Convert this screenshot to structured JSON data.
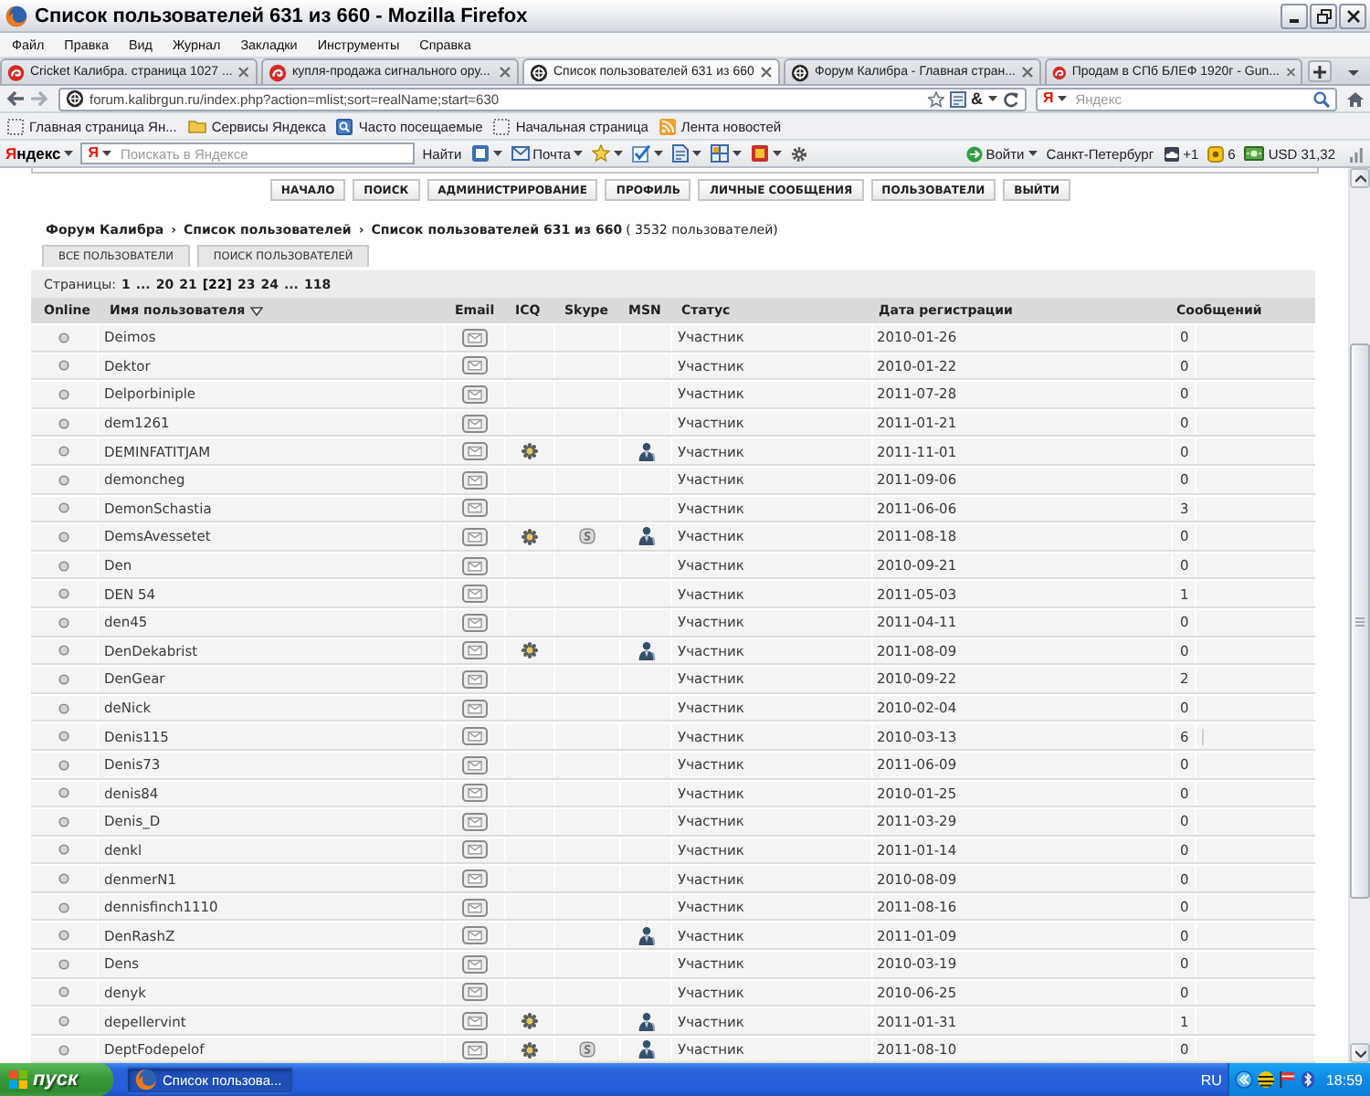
{
  "window": {
    "title": "Список пользователей 631 из 660 - Mozilla Firefox"
  },
  "menu": [
    "Файл",
    "Правка",
    "Вид",
    "Журнал",
    "Закладки",
    "Инструменты",
    "Справка"
  ],
  "tabs": [
    {
      "label": "Cricket Калибра. страница 1027 ...",
      "kind": "page",
      "selected": false
    },
    {
      "label": "купля-продажа сигнального ору...",
      "kind": "page",
      "selected": false
    },
    {
      "label": "Список пользователей 631 из 660",
      "kind": "forum",
      "selected": true
    },
    {
      "label": "Форум Калибра - Главная стран...",
      "kind": "forum",
      "selected": false
    },
    {
      "label": "Продам в СПб БЛЕФ 1920г - Gun...",
      "kind": "page",
      "selected": false
    }
  ],
  "address_bar": {
    "url": "forum.kalibrgun.ru/index.php?action=mlist;sort=realName;start=630",
    "addon": "&"
  },
  "search": {
    "engine": "Я",
    "placeholder": "Яндекс"
  },
  "bookmarks": [
    {
      "label": "Главная страница Ян...",
      "kind": "page"
    },
    {
      "label": "Сервисы Яндекса",
      "kind": "folder"
    },
    {
      "label": "Часто посещаемые",
      "kind": "smart"
    },
    {
      "label": "Начальная страница",
      "kind": "page"
    },
    {
      "label": "Лента новостей",
      "kind": "feed"
    }
  ],
  "toolbar": {
    "logo": "Яндекс",
    "search_logo": "Я",
    "placeholder": "Поискать в Яндексе",
    "search_button": "Найти",
    "mail": "Почта",
    "login": "Войти",
    "city": "Санкт-Петербург",
    "informers": [
      {
        "kind": "weather",
        "label": "+1"
      },
      {
        "kind": "traffic",
        "label": "6"
      },
      {
        "kind": "currency",
        "label": "USD 31,32"
      }
    ]
  },
  "forum": {
    "nav": [
      "НАЧАЛО",
      "ПОИСК",
      "АДМИНИСТРИРОВАНИЕ",
      "ПРОФИЛЬ",
      "ЛИЧНЫЕ СООБЩЕНИЯ",
      "ПОЛЬЗОВАТЕЛИ",
      "ВЫЙТИ"
    ],
    "breadcrumb": {
      "items": [
        "Форум Калибра",
        "Список пользователей",
        "Список пользователей 631 из 660"
      ],
      "separators": [
        "›",
        "›"
      ],
      "count": "( 3532 пользователей)"
    },
    "subtabs": [
      "ВСЕ ПОЛЬЗОВАТЕЛИ",
      "ПОИСК ПОЛЬЗОВАТЕЛЕЙ"
    ],
    "pages": {
      "label": "Страницы:",
      "items": [
        {
          "label": "1",
          "kind": "link"
        },
        {
          "label": "...",
          "kind": "gap"
        },
        {
          "label": "20",
          "kind": "link"
        },
        {
          "label": "21",
          "kind": "link"
        },
        {
          "label": "[22]",
          "kind": "current"
        },
        {
          "label": "23",
          "kind": "link"
        },
        {
          "label": "24",
          "kind": "link"
        },
        {
          "label": "...",
          "kind": "gap"
        },
        {
          "label": "118",
          "kind": "link"
        }
      ]
    },
    "table": {
      "columns": [
        {
          "label": "Online",
          "sorted": false
        },
        {
          "label": "Имя пользователя",
          "sorted": true
        },
        {
          "label": "Email",
          "sorted": false
        },
        {
          "label": "ICQ",
          "sorted": false
        },
        {
          "label": "Skype",
          "sorted": false
        },
        {
          "label": "MSN",
          "sorted": false
        },
        {
          "label": "Статус",
          "sorted": false
        },
        {
          "label": "Дата регистрации",
          "sorted": false
        },
        {
          "label": "Сообщений",
          "sorted": false
        }
      ],
      "rows": [
        {
          "online": false,
          "name": "Deimos",
          "email": true,
          "icq": false,
          "skype": false,
          "msn": false,
          "status": "Участник",
          "registered": "2010-01-26",
          "posts": "0",
          "level": 0
        },
        {
          "online": false,
          "name": "Dektor",
          "email": true,
          "icq": false,
          "skype": false,
          "msn": false,
          "status": "Участник",
          "registered": "2010-01-22",
          "posts": "0",
          "level": 0
        },
        {
          "online": false,
          "name": "Delporbiniple",
          "email": true,
          "icq": false,
          "skype": false,
          "msn": false,
          "status": "Участник",
          "registered": "2011-07-28",
          "posts": "0",
          "level": 0
        },
        {
          "online": false,
          "name": "dem1261",
          "email": true,
          "icq": false,
          "skype": false,
          "msn": false,
          "status": "Участник",
          "registered": "2011-01-21",
          "posts": "0",
          "level": 0
        },
        {
          "online": false,
          "name": "DEMINFATITJAM",
          "email": true,
          "icq": true,
          "skype": false,
          "msn": true,
          "status": "Участник",
          "registered": "2011-11-01",
          "posts": "0",
          "level": 0
        },
        {
          "online": false,
          "name": "demoncheg",
          "email": true,
          "icq": false,
          "skype": false,
          "msn": false,
          "status": "Участник",
          "registered": "2011-09-06",
          "posts": "0",
          "level": 0
        },
        {
          "online": false,
          "name": "DemonSchastia",
          "email": true,
          "icq": false,
          "skype": false,
          "msn": false,
          "status": "Участник",
          "registered": "2011-06-06",
          "posts": "3",
          "level": 0
        },
        {
          "online": false,
          "name": "DemsAvessetet",
          "email": true,
          "icq": true,
          "skype": true,
          "msn": true,
          "status": "Участник",
          "registered": "2011-08-18",
          "posts": "0",
          "level": 0
        },
        {
          "online": false,
          "name": "Den",
          "email": true,
          "icq": false,
          "skype": false,
          "msn": false,
          "status": "Участник",
          "registered": "2010-09-21",
          "posts": "0",
          "level": 0
        },
        {
          "online": false,
          "name": "DEN 54",
          "email": true,
          "icq": false,
          "skype": false,
          "msn": false,
          "status": "Участник",
          "registered": "2011-05-03",
          "posts": "1",
          "level": 0
        },
        {
          "online": false,
          "name": "den45",
          "email": true,
          "icq": false,
          "skype": false,
          "msn": false,
          "status": "Участник",
          "registered": "2011-04-11",
          "posts": "0",
          "level": 0
        },
        {
          "online": false,
          "name": "DenDekabrist",
          "email": true,
          "icq": true,
          "skype": false,
          "msn": true,
          "status": "Участник",
          "registered": "2011-08-09",
          "posts": "0",
          "level": 0
        },
        {
          "online": false,
          "name": "DenGear",
          "email": true,
          "icq": false,
          "skype": false,
          "msn": false,
          "status": "Участник",
          "registered": "2010-09-22",
          "posts": "2",
          "level": 0
        },
        {
          "online": false,
          "name": "deNick",
          "email": true,
          "icq": false,
          "skype": false,
          "msn": false,
          "status": "Участник",
          "registered": "2010-02-04",
          "posts": "0",
          "level": 0
        },
        {
          "online": false,
          "name": "Denis115",
          "email": true,
          "icq": false,
          "skype": false,
          "msn": false,
          "status": "Участник",
          "registered": "2010-03-13",
          "posts": "6",
          "level": 0.02
        },
        {
          "online": false,
          "name": "Denis73",
          "email": true,
          "icq": false,
          "skype": false,
          "msn": false,
          "status": "Участник",
          "registered": "2011-06-09",
          "posts": "0",
          "level": 0
        },
        {
          "online": false,
          "name": "denis84",
          "email": true,
          "icq": false,
          "skype": false,
          "msn": false,
          "status": "Участник",
          "registered": "2010-01-25",
          "posts": "0",
          "level": 0
        },
        {
          "online": false,
          "name": "Denis_D",
          "email": true,
          "icq": false,
          "skype": false,
          "msn": false,
          "status": "Участник",
          "registered": "2011-03-29",
          "posts": "0",
          "level": 0
        },
        {
          "online": false,
          "name": "denkl",
          "email": true,
          "icq": false,
          "skype": false,
          "msn": false,
          "status": "Участник",
          "registered": "2011-01-14",
          "posts": "0",
          "level": 0
        },
        {
          "online": false,
          "name": "denmerN1",
          "email": true,
          "icq": false,
          "skype": false,
          "msn": false,
          "status": "Участник",
          "registered": "2010-08-09",
          "posts": "0",
          "level": 0
        },
        {
          "online": false,
          "name": "dennisfinch1110",
          "email": true,
          "icq": false,
          "skype": false,
          "msn": false,
          "status": "Участник",
          "registered": "2011-08-16",
          "posts": "0",
          "level": 0
        },
        {
          "online": false,
          "name": "DenRashZ",
          "email": true,
          "icq": false,
          "skype": false,
          "msn": true,
          "status": "Участник",
          "registered": "2011-01-09",
          "posts": "0",
          "level": 0
        },
        {
          "online": false,
          "name": "Dens",
          "email": true,
          "icq": false,
          "skype": false,
          "msn": false,
          "status": "Участник",
          "registered": "2010-03-19",
          "posts": "0",
          "level": 0
        },
        {
          "online": false,
          "name": "denyk",
          "email": true,
          "icq": false,
          "skype": false,
          "msn": false,
          "status": "Участник",
          "registered": "2010-06-25",
          "posts": "0",
          "level": 0
        },
        {
          "online": false,
          "name": "depellervint",
          "email": true,
          "icq": true,
          "skype": false,
          "msn": true,
          "status": "Участник",
          "registered": "2011-01-31",
          "posts": "1",
          "level": 0
        },
        {
          "online": false,
          "name": "DeptFodepelof",
          "email": true,
          "icq": true,
          "skype": true,
          "msn": true,
          "status": "Участник",
          "registered": "2011-08-10",
          "posts": "0",
          "level": 0
        }
      ]
    }
  },
  "taskbar": {
    "start": "пуск",
    "tasks": [
      {
        "label": "Список пользова...",
        "selected": true
      }
    ],
    "language": "RU",
    "clock": "18:59"
  }
}
